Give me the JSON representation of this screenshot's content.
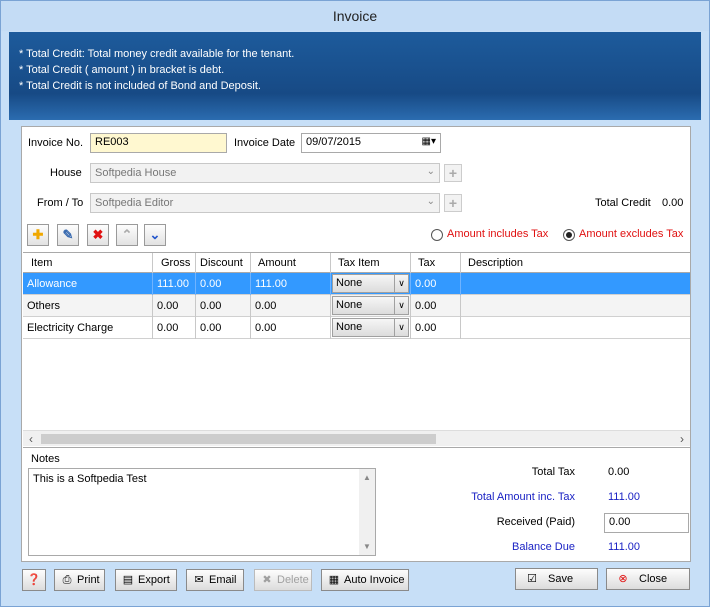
{
  "window": {
    "title": "Invoice"
  },
  "banner": {
    "lines": [
      "* Total Credit: Total money credit available for the tenant.",
      "* Total Credit ( amount ) in bracket is debt.",
      "* Total Credit is not included of Bond and Deposit."
    ]
  },
  "form": {
    "invoice_no_label": "Invoice No.",
    "invoice_no_value": "RE003",
    "invoice_date_label": "Invoice Date",
    "invoice_date_value": "09/07/2015",
    "house_label": "House",
    "house_value": "Softpedia House",
    "from_to_label": "From / To",
    "from_to_value": "Softpedia Editor",
    "total_credit_label": "Total Credit",
    "total_credit_value": "0.00"
  },
  "tax_mode": {
    "includes_label": "Amount includes Tax",
    "excludes_label": "Amount excludes Tax",
    "selected": "excludes"
  },
  "grid": {
    "columns": [
      "Item",
      "Gross",
      "Discount",
      "Amount",
      "Tax Item",
      "Tax",
      "Description"
    ],
    "rows": [
      {
        "item": "Allowance",
        "gross": "111.00",
        "discount": "0.00",
        "amount": "111.00",
        "tax_item": "None",
        "tax": "0.00",
        "description": ""
      },
      {
        "item": "Others",
        "gross": "0.00",
        "discount": "0.00",
        "amount": "0.00",
        "tax_item": "None",
        "tax": "0.00",
        "description": ""
      },
      {
        "item": "Electricity Charge",
        "gross": "0.00",
        "discount": "0.00",
        "amount": "0.00",
        "tax_item": "None",
        "tax": "0.00",
        "description": ""
      }
    ]
  },
  "notes": {
    "label": "Notes",
    "text": "This is a Softpedia Test"
  },
  "summary": {
    "total_tax_label": "Total Tax",
    "total_tax_value": "0.00",
    "total_inc_tax_label": "Total  Amount inc. Tax",
    "total_inc_tax_value": "111.00",
    "received_label": "Received (Paid)",
    "received_value": "0.00",
    "balance_due_label": "Balance Due",
    "balance_due_value": "111.00"
  },
  "buttons": {
    "print": "Print",
    "export": "Export",
    "email": "Email",
    "delete": "Delete",
    "auto_invoice": "Auto Invoice",
    "save": "Save",
    "close": "Close"
  },
  "colors": {
    "banner": "#1d5b9c",
    "selected_row": "#3399ff",
    "warning_text": "#e01010",
    "summary_blue": "#1a22c4",
    "window_bg": "#c7dff7"
  }
}
